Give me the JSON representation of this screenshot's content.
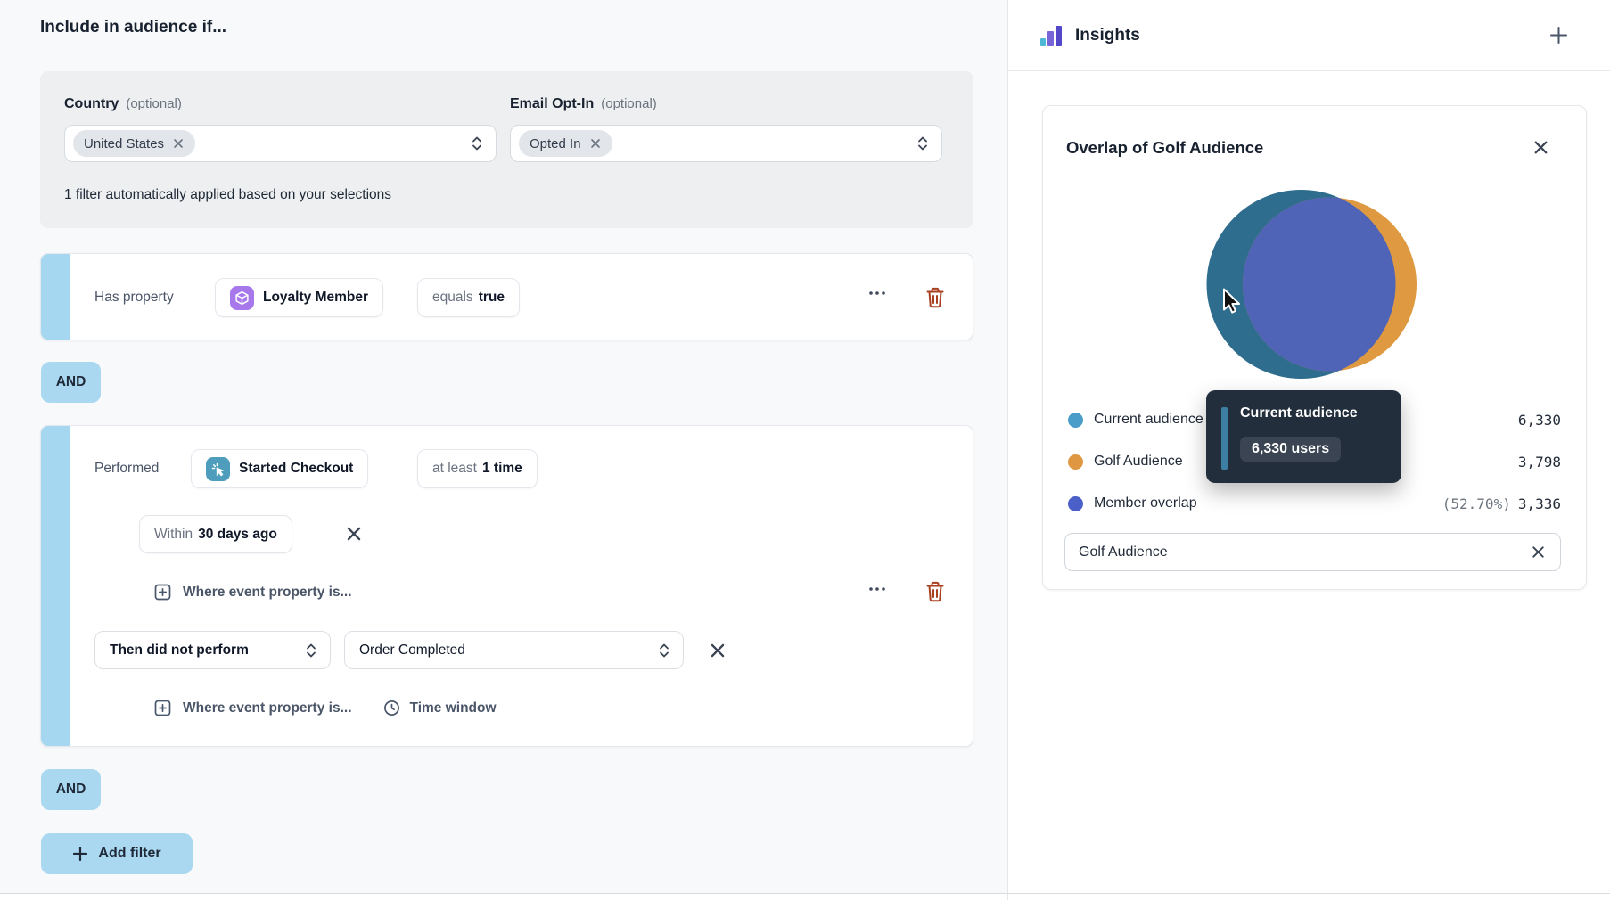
{
  "left_panel": {
    "title": "Include in audience if...",
    "traits": {
      "country_label": "Country",
      "country_optional": "(optional)",
      "country_chip": "United States",
      "email_label": "Email Opt-In",
      "email_optional": "(optional)",
      "email_chip": "Opted In",
      "note": "1 filter automatically applied based on your selections"
    },
    "condition_property": {
      "prefix": "Has property",
      "property": "Loyalty Member",
      "operator": "equals",
      "value": "true"
    },
    "and_label": "AND",
    "condition_event": {
      "prefix": "Performed",
      "event": "Started Checkout",
      "frequency_prefix": "at least",
      "frequency_value": "1 time",
      "window_prefix": "Within",
      "window_value": "30 days ago",
      "where_property": "Where event property is...",
      "then_operator": "Then did not perform",
      "then_event": "Order Completed",
      "time_window": "Time window"
    },
    "add_filter_label": "Add filter"
  },
  "right_panel": {
    "header_title": "Insights",
    "card": {
      "title": "Overlap of Golf Audience",
      "legend": [
        {
          "label": "Current audience",
          "value": "6,330",
          "color": "#4A9CC9"
        },
        {
          "label": "Golf Audience",
          "value": "3,798",
          "color": "#DF9741"
        },
        {
          "label": "Member overlap",
          "percent": "(52.70%)",
          "value": "3,336",
          "color": "#4A5FC8"
        }
      ],
      "tooltip": {
        "title": "Current audience",
        "value": "6,330 users"
      },
      "input_value": "Golf Audience"
    }
  },
  "chart_data": {
    "type": "venn",
    "title": "Overlap of Golf Audience",
    "sets": [
      {
        "name": "Current audience",
        "size": 6330,
        "color": "#2E6D8E"
      },
      {
        "name": "Golf Audience",
        "size": 3798,
        "color": "#DF9A41"
      }
    ],
    "overlap": {
      "name": "Member overlap",
      "size": 3336,
      "percent": "52.70%",
      "color": "#4F63B7"
    },
    "legend_position": "bottom"
  }
}
